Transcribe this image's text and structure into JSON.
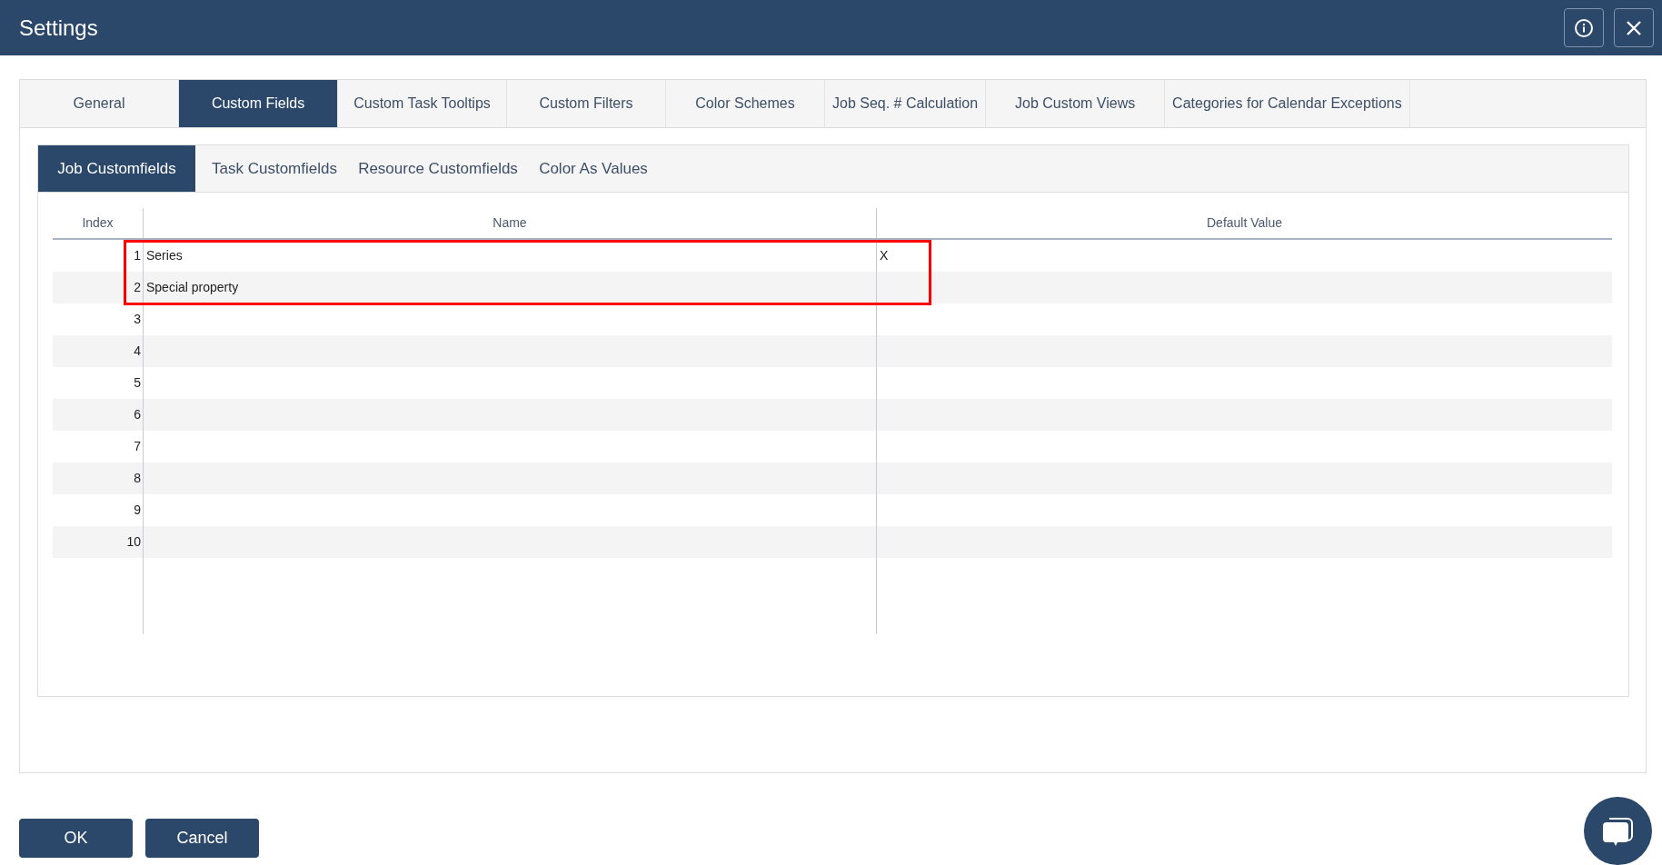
{
  "window": {
    "title": "Settings"
  },
  "tabs": [
    {
      "label": "General",
      "selected": false
    },
    {
      "label": "Custom Fields",
      "selected": true
    },
    {
      "label": "Custom Task Tooltips",
      "selected": false
    },
    {
      "label": "Custom Filters",
      "selected": false
    },
    {
      "label": "Color Schemes",
      "selected": false
    },
    {
      "label": "Job Seq. # Calculation",
      "selected": false
    },
    {
      "label": "Job Custom Views",
      "selected": false
    },
    {
      "label": "Categories for Calendar Exceptions",
      "selected": false
    }
  ],
  "subtabs": [
    {
      "label": "Job Customfields",
      "selected": true
    },
    {
      "label": "Task Customfields",
      "selected": false
    },
    {
      "label": "Resource Customfields",
      "selected": false
    },
    {
      "label": "Color As Values",
      "selected": false
    }
  ],
  "table": {
    "columns": [
      "Index",
      "Name",
      "Default Value"
    ],
    "rows": [
      {
        "index": "1",
        "name": "Series",
        "default_value": "X",
        "highlighted": true
      },
      {
        "index": "2",
        "name": "Special property",
        "highlighted": true
      },
      {
        "index": "3",
        "highlighted": false
      },
      {
        "index": "4",
        "highlighted": false
      },
      {
        "index": "5",
        "highlighted": false
      },
      {
        "index": "6",
        "highlighted": false
      },
      {
        "index": "7",
        "highlighted": false
      },
      {
        "index": "8",
        "highlighted": false
      },
      {
        "index": "9",
        "highlighted": false
      },
      {
        "index": "10",
        "highlighted": false
      }
    ]
  },
  "buttons": [
    "OK",
    "Cancel"
  ]
}
